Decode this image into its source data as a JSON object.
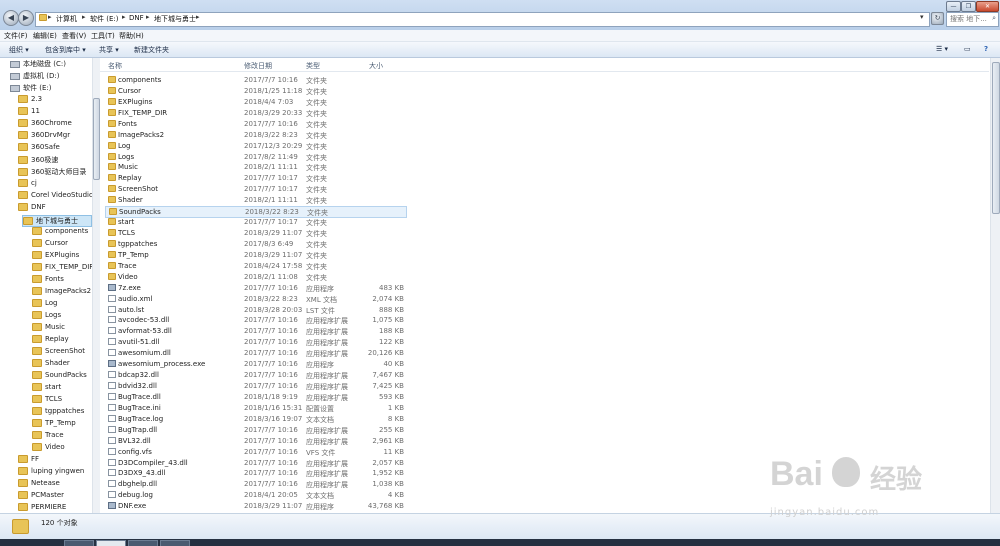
{
  "address": {
    "segments": [
      "计算机",
      "软件 (E:)",
      "DNF",
      "地下城与勇士"
    ],
    "search_placeholder": "搜索 地下..."
  },
  "menu": [
    "文件(F)",
    "编辑(E)",
    "查看(V)",
    "工具(T)",
    "帮助(H)"
  ],
  "toolbar": {
    "organize": "组织 ▾",
    "include": "包含到库中 ▾",
    "share": "共享 ▾",
    "new_folder": "新建文件夹"
  },
  "nav": [
    {
      "label": "本地磁盘 (C:)",
      "type": "drive",
      "indent": 1
    },
    {
      "label": "虚拟机 (D:)",
      "type": "drive",
      "indent": 1
    },
    {
      "label": "软件 (E:)",
      "type": "drive",
      "indent": 1
    },
    {
      "label": "2.3",
      "type": "folder",
      "indent": 2
    },
    {
      "label": "11",
      "type": "folder",
      "indent": 2
    },
    {
      "label": "360Chrome",
      "type": "folder",
      "indent": 2
    },
    {
      "label": "360DrvMgr",
      "type": "folder",
      "indent": 2
    },
    {
      "label": "360Safe",
      "type": "folder",
      "indent": 2
    },
    {
      "label": "360极速",
      "type": "folder",
      "indent": 2
    },
    {
      "label": "360驱动大师目录",
      "type": "folder",
      "indent": 2
    },
    {
      "label": "cj",
      "type": "folder",
      "indent": 2
    },
    {
      "label": "Corel VideoStudio",
      "type": "folder",
      "indent": 2
    },
    {
      "label": "DNF",
      "type": "folder",
      "indent": 2
    },
    {
      "label": "地下城与勇士",
      "type": "folder",
      "indent": 3,
      "selected": true
    },
    {
      "label": "components",
      "type": "folder",
      "indent": 4
    },
    {
      "label": "Cursor",
      "type": "folder",
      "indent": 4
    },
    {
      "label": "EXPlugins",
      "type": "folder",
      "indent": 4
    },
    {
      "label": "FIX_TEMP_DIR",
      "type": "folder",
      "indent": 4
    },
    {
      "label": "Fonts",
      "type": "folder",
      "indent": 4
    },
    {
      "label": "ImagePacks2",
      "type": "folder",
      "indent": 4
    },
    {
      "label": "Log",
      "type": "folder",
      "indent": 4
    },
    {
      "label": "Logs",
      "type": "folder",
      "indent": 4
    },
    {
      "label": "Music",
      "type": "folder",
      "indent": 4
    },
    {
      "label": "Replay",
      "type": "folder",
      "indent": 4
    },
    {
      "label": "ScreenShot",
      "type": "folder",
      "indent": 4
    },
    {
      "label": "Shader",
      "type": "folder",
      "indent": 4
    },
    {
      "label": "SoundPacks",
      "type": "folder",
      "indent": 4
    },
    {
      "label": "start",
      "type": "folder",
      "indent": 4
    },
    {
      "label": "TCLS",
      "type": "folder",
      "indent": 4
    },
    {
      "label": "tgppatches",
      "type": "folder",
      "indent": 4
    },
    {
      "label": "TP_Temp",
      "type": "folder",
      "indent": 4
    },
    {
      "label": "Trace",
      "type": "folder",
      "indent": 4
    },
    {
      "label": "Video",
      "type": "folder",
      "indent": 4
    },
    {
      "label": "FF",
      "type": "folder",
      "indent": 2
    },
    {
      "label": "luping yingwen",
      "type": "folder",
      "indent": 2
    },
    {
      "label": "Netease",
      "type": "folder",
      "indent": 2
    },
    {
      "label": "PCMaster",
      "type": "folder",
      "indent": 2
    },
    {
      "label": "PERMIERE",
      "type": "folder",
      "indent": 2
    }
  ],
  "columns": {
    "name": "名称",
    "date": "修改日期",
    "type": "类型",
    "size": "大小"
  },
  "files": [
    {
      "name": "components",
      "date": "2017/7/7 10:16",
      "type": "文件夹",
      "size": "",
      "icon": "folder"
    },
    {
      "name": "Cursor",
      "date": "2018/1/25 11:18",
      "type": "文件夹",
      "size": "",
      "icon": "folder"
    },
    {
      "name": "EXPlugins",
      "date": "2018/4/4 7:03",
      "type": "文件夹",
      "size": "",
      "icon": "folder"
    },
    {
      "name": "FIX_TEMP_DIR",
      "date": "2018/3/29 20:33",
      "type": "文件夹",
      "size": "",
      "icon": "folder"
    },
    {
      "name": "Fonts",
      "date": "2017/7/7 10:16",
      "type": "文件夹",
      "size": "",
      "icon": "folder"
    },
    {
      "name": "ImagePacks2",
      "date": "2018/3/22 8:23",
      "type": "文件夹",
      "size": "",
      "icon": "folder"
    },
    {
      "name": "Log",
      "date": "2017/12/3 20:29",
      "type": "文件夹",
      "size": "",
      "icon": "folder"
    },
    {
      "name": "Logs",
      "date": "2017/8/2 11:49",
      "type": "文件夹",
      "size": "",
      "icon": "folder"
    },
    {
      "name": "Music",
      "date": "2018/2/1 11:11",
      "type": "文件夹",
      "size": "",
      "icon": "folder"
    },
    {
      "name": "Replay",
      "date": "2017/7/7 10:17",
      "type": "文件夹",
      "size": "",
      "icon": "folder"
    },
    {
      "name": "ScreenShot",
      "date": "2017/7/7 10:17",
      "type": "文件夹",
      "size": "",
      "icon": "folder"
    },
    {
      "name": "Shader",
      "date": "2018/2/1 11:11",
      "type": "文件夹",
      "size": "",
      "icon": "folder"
    },
    {
      "name": "SoundPacks",
      "date": "2018/3/22 8:23",
      "type": "文件夹",
      "size": "",
      "icon": "folder",
      "selected": true
    },
    {
      "name": "start",
      "date": "2017/7/7 10:17",
      "type": "文件夹",
      "size": "",
      "icon": "folder"
    },
    {
      "name": "TCLS",
      "date": "2018/3/29 11:07",
      "type": "文件夹",
      "size": "",
      "icon": "folder"
    },
    {
      "name": "tgppatches",
      "date": "2017/8/3 6:49",
      "type": "文件夹",
      "size": "",
      "icon": "folder"
    },
    {
      "name": "TP_Temp",
      "date": "2018/3/29 11:07",
      "type": "文件夹",
      "size": "",
      "icon": "folder"
    },
    {
      "name": "Trace",
      "date": "2018/4/24 17:58",
      "type": "文件夹",
      "size": "",
      "icon": "folder"
    },
    {
      "name": "Video",
      "date": "2018/2/1 11:08",
      "type": "文件夹",
      "size": "",
      "icon": "folder"
    },
    {
      "name": "7z.exe",
      "date": "2017/7/7 10:16",
      "type": "应用程序",
      "size": "483 KB",
      "icon": "exe"
    },
    {
      "name": "audio.xml",
      "date": "2018/3/22 8:23",
      "type": "XML 文档",
      "size": "2,074 KB",
      "icon": "file"
    },
    {
      "name": "auto.lst",
      "date": "2018/3/28 20:03",
      "type": "LST 文件",
      "size": "888 KB",
      "icon": "file"
    },
    {
      "name": "avcodec-53.dll",
      "date": "2017/7/7 10:16",
      "type": "应用程序扩展",
      "size": "1,075 KB",
      "icon": "file"
    },
    {
      "name": "avformat-53.dll",
      "date": "2017/7/7 10:16",
      "type": "应用程序扩展",
      "size": "188 KB",
      "icon": "file"
    },
    {
      "name": "avutil-51.dll",
      "date": "2017/7/7 10:16",
      "type": "应用程序扩展",
      "size": "122 KB",
      "icon": "file"
    },
    {
      "name": "awesomium.dll",
      "date": "2017/7/7 10:16",
      "type": "应用程序扩展",
      "size": "20,126 KB",
      "icon": "file"
    },
    {
      "name": "awesomium_process.exe",
      "date": "2017/7/7 10:16",
      "type": "应用程序",
      "size": "40 KB",
      "icon": "exe"
    },
    {
      "name": "bdcap32.dll",
      "date": "2017/7/7 10:16",
      "type": "应用程序扩展",
      "size": "7,467 KB",
      "icon": "file"
    },
    {
      "name": "bdvid32.dll",
      "date": "2017/7/7 10:16",
      "type": "应用程序扩展",
      "size": "7,425 KB",
      "icon": "file"
    },
    {
      "name": "BugTrace.dll",
      "date": "2018/1/18 9:19",
      "type": "应用程序扩展",
      "size": "593 KB",
      "icon": "file"
    },
    {
      "name": "BugTrace.ini",
      "date": "2018/1/16 15:31",
      "type": "配置设置",
      "size": "1 KB",
      "icon": "file"
    },
    {
      "name": "BugTrace.log",
      "date": "2018/3/16 19:07",
      "type": "文本文档",
      "size": "8 KB",
      "icon": "file"
    },
    {
      "name": "BugTrap.dll",
      "date": "2017/7/7 10:16",
      "type": "应用程序扩展",
      "size": "255 KB",
      "icon": "file"
    },
    {
      "name": "BVL32.dll",
      "date": "2017/7/7 10:16",
      "type": "应用程序扩展",
      "size": "2,961 KB",
      "icon": "file"
    },
    {
      "name": "config.vfs",
      "date": "2017/7/7 10:16",
      "type": "VFS 文件",
      "size": "11 KB",
      "icon": "file"
    },
    {
      "name": "D3DCompiler_43.dll",
      "date": "2017/7/7 10:16",
      "type": "应用程序扩展",
      "size": "2,057 KB",
      "icon": "file"
    },
    {
      "name": "D3DX9_43.dll",
      "date": "2017/7/7 10:16",
      "type": "应用程序扩展",
      "size": "1,952 KB",
      "icon": "file"
    },
    {
      "name": "dbghelp.dll",
      "date": "2017/7/7 10:16",
      "type": "应用程序扩展",
      "size": "1,038 KB",
      "icon": "file"
    },
    {
      "name": "debug.log",
      "date": "2018/4/1 20:05",
      "type": "文本文档",
      "size": "4 KB",
      "icon": "file"
    },
    {
      "name": "DNF.exe",
      "date": "2018/3/29 11:07",
      "type": "应用程序",
      "size": "43,768 KB",
      "icon": "exe"
    }
  ],
  "status": {
    "count": "120 个对象"
  },
  "watermark": {
    "brand": "Bai",
    "brand2": "经验",
    "url": "jingyan.baidu.com"
  }
}
